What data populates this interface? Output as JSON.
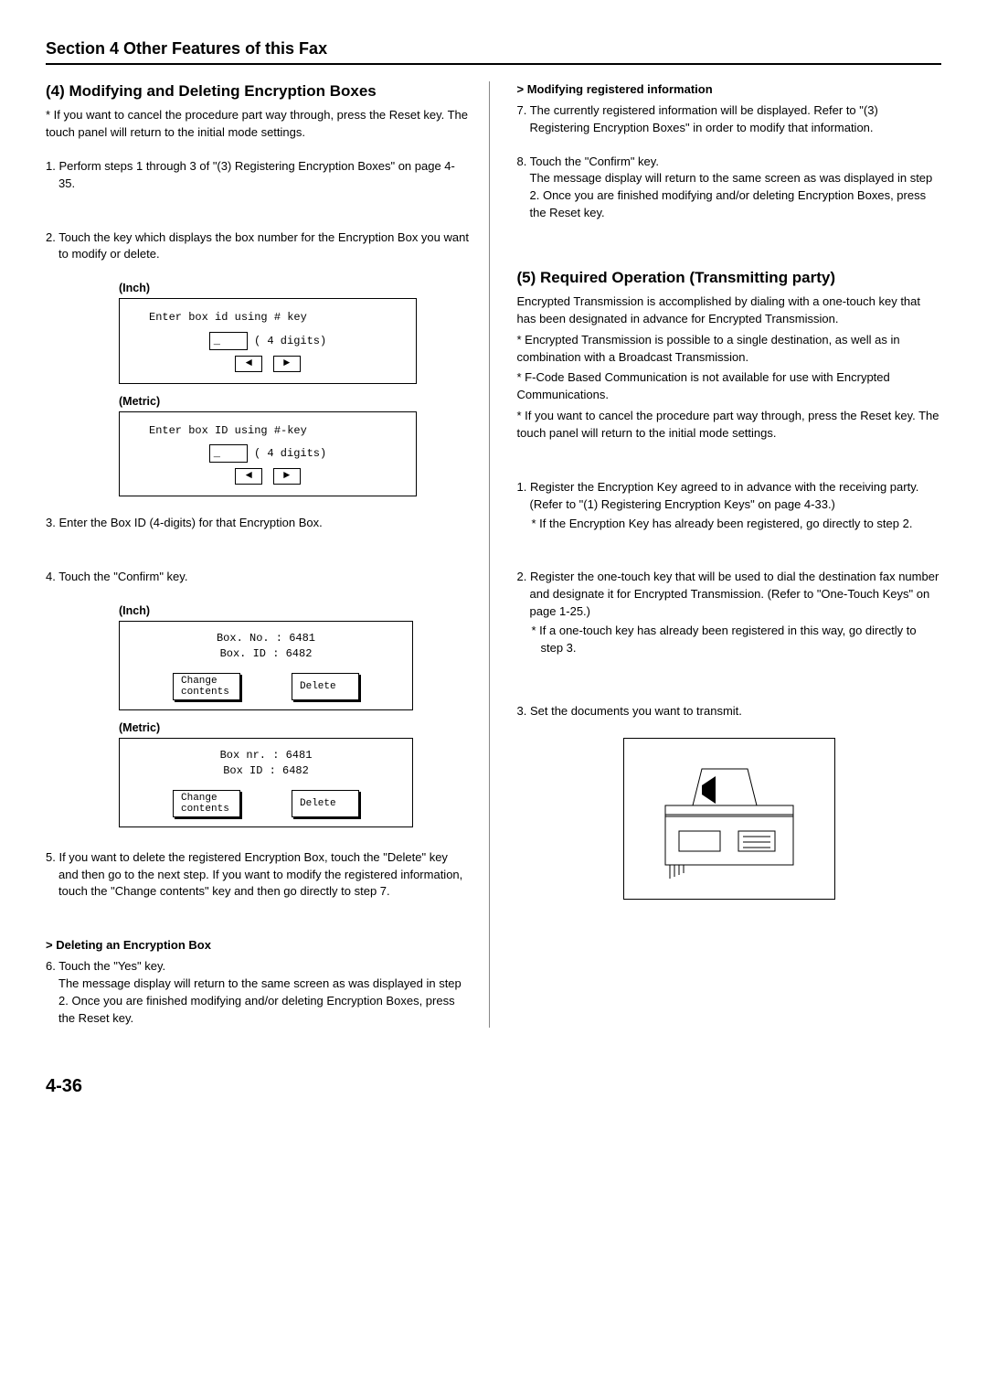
{
  "header": "Section 4 Other Features of this Fax",
  "left": {
    "title": "(4) Modifying and Deleting Encryption Boxes",
    "note1": "* If you want to cancel the procedure part way through, press the Reset key. The touch panel will return to the initial mode settings.",
    "step1": "1. Perform steps 1 through 3 of \"(3) Registering Encryption Boxes\" on page 4-35.",
    "step2": "2. Touch the key which displays the box number for the Encryption Box you want to modify or delete.",
    "inchLabel": "(Inch)",
    "metricLabel": "(Metric)",
    "panel1Inch": {
      "text": "Enter box id using # key",
      "cursor": "_",
      "digits": "( 4 digits)"
    },
    "panel1Metric": {
      "text": "Enter box ID using #-key",
      "cursor": "_",
      "digits": "( 4 digits)"
    },
    "step3": "3. Enter the Box ID (4-digits) for that Encryption Box.",
    "step4": "4. Touch the \"Confirm\" key.",
    "panel2Inch": {
      "line1": "Box. No. : 6481",
      "line2": "Box. ID   : 6482",
      "btnChange": "Change\ncontents",
      "btnDelete": "Delete"
    },
    "panel2Metric": {
      "line1": "Box nr. : 6481",
      "line2": "Box ID  : 6482",
      "btnChange": "Change\ncontents",
      "btnDelete": "Delete"
    },
    "step5": "5. If you want to delete the registered Encryption Box, touch the \"Delete\" key and then go to the next step. If you want to modify the registered information, touch the \"Change contents\" key and then go directly to step 7.",
    "delHead": "> Deleting an Encryption Box",
    "step6": "6. Touch the \"Yes\" key.",
    "step6b": "The message display will return to the same screen as was displayed in step 2. Once you are finished modifying and/or deleting Encryption Boxes, press the Reset key."
  },
  "right": {
    "modHead": "> Modifying registered information",
    "step7": "7. The currently registered information will be displayed. Refer to \"(3) Registering Encryption Boxes\" in order to modify that information.",
    "step8": "8. Touch the \"Confirm\" key.",
    "step8b": "The message display will return to the same screen as was displayed in step 2. Once you are finished modifying and/or deleting Encryption Boxes, press the Reset key.",
    "title5": "(5) Required Operation (Transmitting party)",
    "intro": "Encrypted Transmission is accomplished by dialing with a one-touch key that has been designated in advance for Encrypted Transmission.",
    "star1": "* Encrypted Transmission is possible to a single destination, as well as in combination with a Broadcast Transmission.",
    "star2": "* F-Code Based Communication is not available for use with Encrypted Communications.",
    "star3": "* If you want to cancel the procedure part way through, press the Reset key. The touch panel will return to the initial mode settings.",
    "r1": "1. Register the Encryption Key agreed to in advance with the receiving party. (Refer to \"(1) Registering Encryption Keys\" on page 4-33.)",
    "r1sub": "* If the Encryption Key has already been registered, go directly to step 2.",
    "r2": "2. Register the one-touch key that will be used to dial the destination fax number and designate it for Encrypted Transmission. (Refer to \"One-Touch Keys\" on page 1-25.)",
    "r2sub": "* If a one-touch key has already been registered in this way, go directly to step 3.",
    "r3": "3. Set the documents you want to transmit."
  },
  "pageNum": "4-36"
}
